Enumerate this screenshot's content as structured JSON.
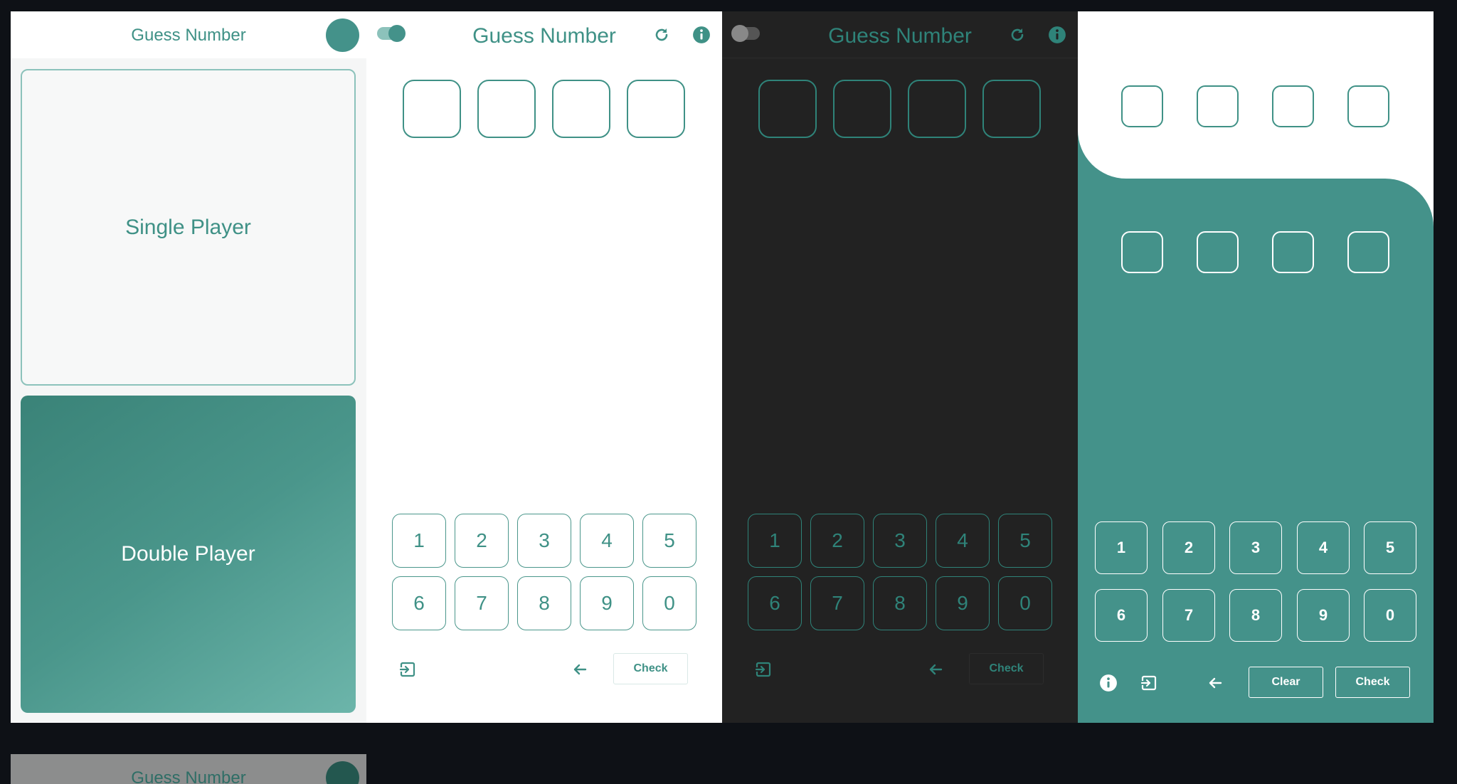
{
  "menu": {
    "title": "Guess Number",
    "single_player_label": "Single Player",
    "double_player_label": "Double Player"
  },
  "light_game": {
    "title": "Guess Number",
    "theme_toggle_on": true,
    "keypad": [
      "1",
      "2",
      "3",
      "4",
      "5",
      "6",
      "7",
      "8",
      "9",
      "0"
    ],
    "check_label": "Check"
  },
  "dark_game": {
    "title": "Guess Number",
    "theme_toggle_on": false,
    "keypad": [
      "1",
      "2",
      "3",
      "4",
      "5",
      "6",
      "7",
      "8",
      "9",
      "0"
    ],
    "check_label": "Check"
  },
  "double_game": {
    "keypad": [
      "1",
      "2",
      "3",
      "4",
      "5",
      "6",
      "7",
      "8",
      "9",
      "0"
    ],
    "clear_label": "Clear",
    "check_label": "Check"
  },
  "ghost_menu": {
    "title": "Guess Number"
  },
  "colors": {
    "accent": "#44928a",
    "accent_text": "#3f9186",
    "dark_bg": "#222222",
    "dark_accent": "#2f8379",
    "page_bg": "#0e1116"
  },
  "icons": [
    "refresh-icon",
    "info-icon",
    "exit-icon",
    "backspace-arrow-icon",
    "avatar"
  ]
}
